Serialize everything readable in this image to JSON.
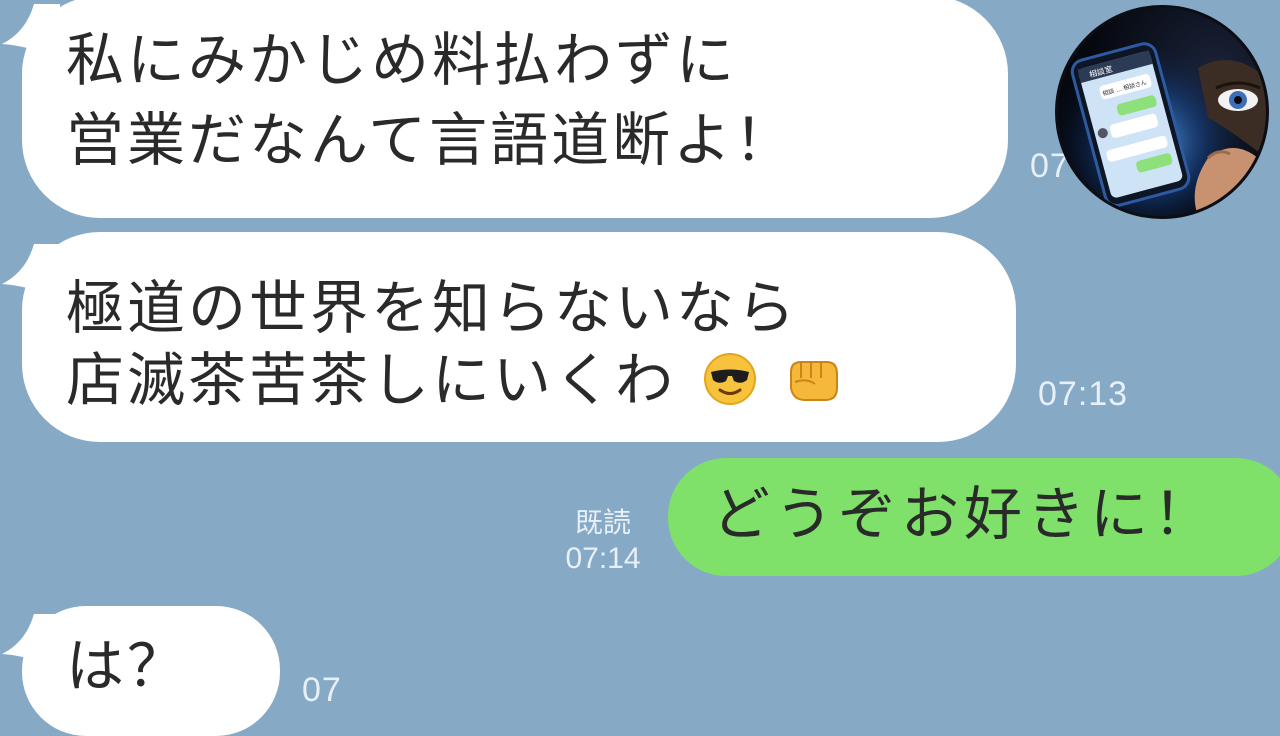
{
  "messages": [
    {
      "id": "m1",
      "side": "received",
      "lines": [
        "私にみかじめ料払わずに",
        "営業だなんて言語道断よ！"
      ],
      "time": "07"
    },
    {
      "id": "m2",
      "side": "received",
      "lines": [
        "極道の世界を知らないなら",
        "店滅茶苦茶しにいくわ"
      ],
      "emojis": [
        "smiling-face-with-sunglasses",
        "oncoming-fist"
      ],
      "time": "07:13"
    },
    {
      "id": "m3",
      "side": "sent",
      "lines": [
        "どうぞお好きに！"
      ],
      "read_label": "既読",
      "time": "07:14"
    },
    {
      "id": "m4",
      "side": "received",
      "lines": [
        "は？"
      ],
      "time": "07"
    }
  ],
  "avatar": {
    "icon": "hooded-figure-holding-smartphone",
    "phone_header": "相談室",
    "phone_bubble_text": "相談 ... 相談さん"
  },
  "colors": {
    "background": "#86a9c6",
    "received_bubble": "#ffffff",
    "sent_bubble": "#7fe06a",
    "timestamp": "#e8f0f7",
    "text": "#2a2a2a"
  }
}
